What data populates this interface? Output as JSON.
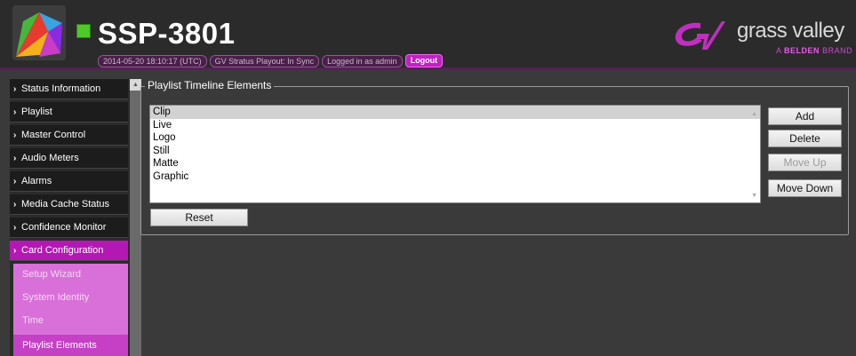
{
  "header": {
    "title": "SSP-3801",
    "status_items": [
      "2014-05-20 18:10:17 (UTC)",
      "GV Stratus Playout: In Sync",
      "Logged in as admin"
    ],
    "logout_label": "Logout",
    "brand_name": "grass valley",
    "brand_sub_prefix": "A",
    "brand_sub_bold": "BELDEN",
    "brand_sub_suffix": "BRAND",
    "status_led_color": "#4ec928"
  },
  "sidebar": {
    "chevron": "›",
    "items": [
      {
        "label": "Status Information"
      },
      {
        "label": "Playlist"
      },
      {
        "label": "Master Control"
      },
      {
        "label": "Audio Meters"
      },
      {
        "label": "Alarms"
      },
      {
        "label": "Media Cache Status"
      },
      {
        "label": "Confidence Monitor"
      },
      {
        "label": "Card Configuration"
      }
    ],
    "sub_items": [
      {
        "label": "Setup Wizard"
      },
      {
        "label": "System Identity"
      },
      {
        "label": "Time"
      },
      {
        "label": "Playlist Elements"
      }
    ]
  },
  "panel": {
    "legend": "Playlist Timeline Elements",
    "list_items": [
      "Clip",
      "Live",
      "Logo",
      "Still",
      "Matte",
      "Graphic"
    ],
    "buttons": {
      "add": "Add",
      "delete": "Delete",
      "move_up": "Move Up",
      "move_down": "Move Down",
      "reset": "Reset"
    }
  },
  "colors": {
    "accent": "#b418b4",
    "submenu": "#d970d9",
    "background": "#3a3a3a"
  }
}
